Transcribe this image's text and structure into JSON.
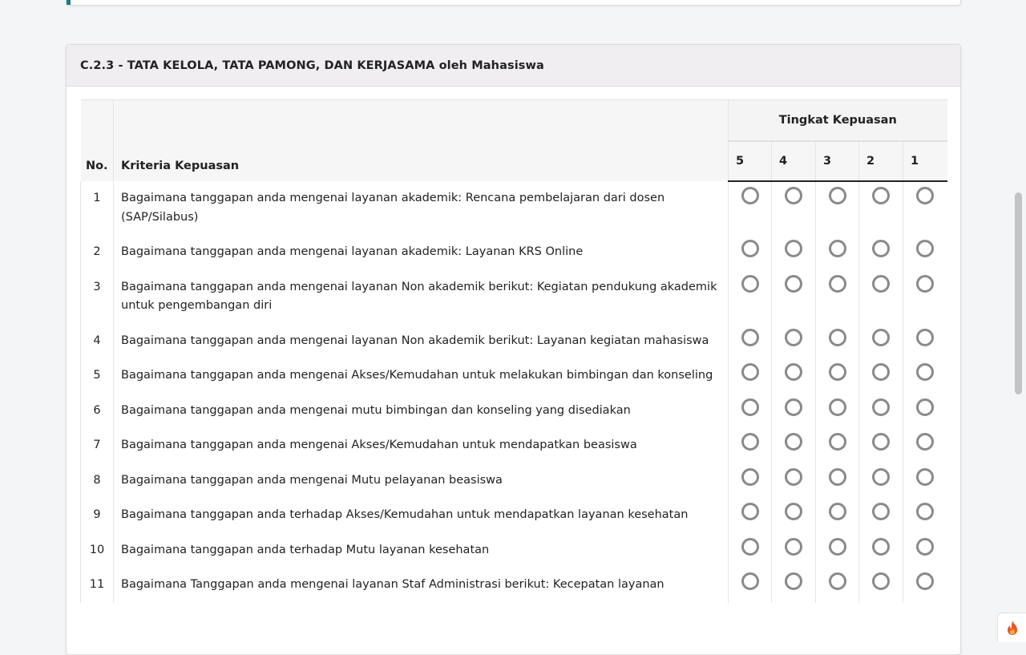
{
  "section": {
    "title": "C.2.3 - TATA KELOLA, TATA PAMONG, DAN KERJASAMA oleh Mahasiswa"
  },
  "table": {
    "col_no": "No.",
    "col_criteria": "Kriteria Kepuasan",
    "group_label": "Tingkat Kepuasan",
    "ratings": [
      "5",
      "4",
      "3",
      "2",
      "1"
    ],
    "rows": [
      {
        "no": "1",
        "text": "Bagaimana tanggapan anda mengenai layanan akademik: Rencana pembelajaran dari dosen (SAP/Silabus)"
      },
      {
        "no": "2",
        "text": "Bagaimana tanggapan anda mengenai layanan akademik: Layanan KRS Online"
      },
      {
        "no": "3",
        "text": "Bagaimana tanggapan anda mengenai layanan Non akademik berikut: Kegiatan pendukung akademik untuk pengembangan diri"
      },
      {
        "no": "4",
        "text": "Bagaimana tanggapan anda mengenai layanan Non akademik berikut: Layanan kegiatan mahasiswa"
      },
      {
        "no": "5",
        "text": "Bagaimana tanggapan anda mengenai Akses/Kemudahan untuk melakukan bimbingan dan konseling"
      },
      {
        "no": "6",
        "text": "Bagaimana tanggapan anda mengenai mutu bimbingan dan konseling yang disediakan"
      },
      {
        "no": "7",
        "text": "Bagaimana tanggapan anda mengenai Akses/Kemudahan untuk mendapatkan beasiswa"
      },
      {
        "no": "8",
        "text": "Bagaimana tanggapan anda mengenai Mutu pelayanan beasiswa"
      },
      {
        "no": "9",
        "text": "Bagaimana tanggapan anda terhadap Akses/Kemudahan untuk mendapatkan layanan kesehatan"
      },
      {
        "no": "10",
        "text": "Bagaimana tanggapan anda terhadap Mutu layanan kesehatan"
      },
      {
        "no": "11",
        "text": "Bagaimana Tanggapan anda mengenai layanan Staf Administrasi berikut: Kecepatan layanan"
      }
    ]
  },
  "colors": {
    "accent": "#167c8e",
    "header_bg": "#f1eef2",
    "radio_border": "#8a8a8a",
    "flame": "#e8552a"
  },
  "icons": {
    "floating_button": "flame-icon"
  }
}
